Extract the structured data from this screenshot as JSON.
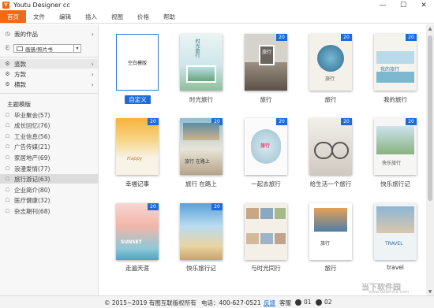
{
  "window": {
    "title": "Youtu Designer cc",
    "min": "—",
    "max": "☐",
    "close": "✕"
  },
  "menu": [
    "首页",
    "文件",
    "编辑",
    "插入",
    "视图",
    "价格",
    "帮助"
  ],
  "sidebar": {
    "my_works": "我的作品",
    "select_value": "画册/照片书",
    "orientations": [
      "竖款",
      "方款",
      "横款"
    ],
    "theme_header": "主题模版",
    "themes": [
      "毕业聚会(57)",
      "成长回忆(76)",
      "工业信息(56)",
      "广告传媒(21)",
      "家居地产(69)",
      "浪漫爱情(77)",
      "旅行游记(63)",
      "企业简介(80)",
      "医疗健康(32)",
      "杂志期刊(68)"
    ],
    "selected_theme_index": 6
  },
  "templates": {
    "badge": "20",
    "blank_card_text": "空白模版",
    "rows": [
      [
        "自定义",
        "时光旅行",
        "旅行",
        "旅行",
        "我的旅行"
      ],
      [
        "幸福记事",
        "旅行 在路上",
        "一起去旅行",
        "给生活一个旅行",
        "快乐旅行记"
      ],
      [
        "走遍天涯",
        "快乐旅行记",
        "与时光同行",
        "旅行",
        "travel"
      ]
    ],
    "card_texts": {
      "r0c1": "时光旅行",
      "r0c2": "旅行",
      "r0c3": "旅行",
      "r0c4": "我的旅行",
      "r1c0": "Happy",
      "r1c1": "旅行 在路上",
      "r1c2": "旅行",
      "r1c4": "快乐旅行",
      "r2c0": "SUNSET",
      "r2c3": "旅行",
      "r2c4": "TRAVEL"
    }
  },
  "footer": {
    "copyright": "© 2015~2019 有图互联版权所有",
    "phone": "电话：400-627-0521",
    "feedback": "反馈",
    "service": "客服",
    "qq1": "01",
    "qq2": "02"
  },
  "watermark": {
    "text": "当下软件园",
    "sub": "www.downxia.com"
  },
  "colors": {
    "accent": "#f06a1a",
    "selection_blue": "#1e6bd8"
  }
}
